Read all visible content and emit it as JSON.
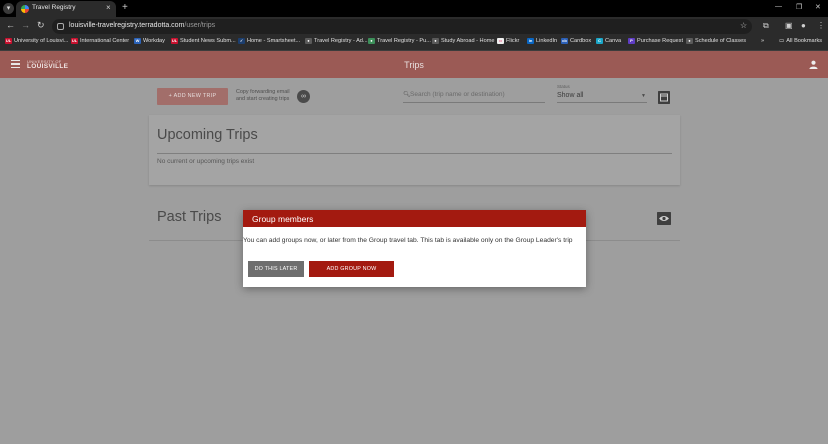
{
  "browser": {
    "tab": {
      "title": "Travel Registry",
      "close": "×",
      "new_tab": "+"
    },
    "tab_list": "▾",
    "window_controls": {
      "minimize": "—",
      "restore": "❐",
      "close": "✕"
    },
    "nav": {
      "back": "←",
      "forward": "→",
      "reload": "↻"
    },
    "url": {
      "host": "louisville-travelregistry.terradotta.com",
      "path": "/user/trips"
    },
    "toolbar_icons": {
      "bookmark_star": "☆",
      "extensions": "⧉",
      "sidebar": "▣",
      "profile": "●",
      "menu": "⋮"
    },
    "bookmarks": [
      {
        "label": "University of Louisvi...",
        "icon_text": "UL",
        "color": "#c8102e"
      },
      {
        "label": "International Center",
        "icon_text": "UL",
        "color": "#c8102e"
      },
      {
        "label": "Workday",
        "icon_text": "W",
        "color": "#2a62b8"
      },
      {
        "label": "Student News Subm...",
        "icon_text": "UL",
        "color": "#c8102e"
      },
      {
        "label": "Home - Smartsheet...",
        "icon_text": "✓",
        "color": "#1c3e6e"
      },
      {
        "label": "Travel Registry - Ad...",
        "icon_text": "●",
        "color": "#5a5a5a"
      },
      {
        "label": "Travel Registry - Pu...",
        "icon_text": "●",
        "color": "#3d8f5a"
      },
      {
        "label": "Study Abroad - Home",
        "icon_text": "●",
        "color": "#5a5a5a"
      },
      {
        "label": "Flickr",
        "icon_text": "••",
        "color": "#eeeeee"
      },
      {
        "label": "LinkedIn",
        "icon_text": "in",
        "color": "#0a66c2"
      },
      {
        "label": "Cardbox",
        "icon_text": "cb",
        "color": "#2b5fb6"
      },
      {
        "label": "Canva",
        "icon_text": "C",
        "color": "#1aa6c8"
      },
      {
        "label": "Purchase Request",
        "icon_text": "P",
        "color": "#5f3dc4"
      },
      {
        "label": "Schedule of Classes",
        "icon_text": "●",
        "color": "#5a5a5a"
      }
    ],
    "more_bookmarks": "»",
    "all_bookmarks": "All Bookmarks"
  },
  "app": {
    "logo_line1": "UNIVERSITY OF",
    "logo_line2": "LOUISVILLE",
    "title": "Trips",
    "add_trip_label": "+ ADD NEW TRIP",
    "copy_text": "Copy forwarding email and start creating trips",
    "search_placeholder": "Search (trip name or destination)",
    "status_label": "Status",
    "status_value": "Show all",
    "upcoming_title": "Upcoming Trips",
    "upcoming_empty": "No current or upcoming trips exist",
    "past_title": "Past Trips"
  },
  "dialog": {
    "title": "Group members",
    "body": "You can add groups now, or later from the Group travel tab. This tab is available only on the Group Leader's trip",
    "later_label": "DO THIS LATER",
    "add_label": "ADD GROUP NOW"
  },
  "colors": {
    "appbar": "#9b5a55",
    "primary": "#a31a10",
    "overlay": "#9e9e9e"
  }
}
